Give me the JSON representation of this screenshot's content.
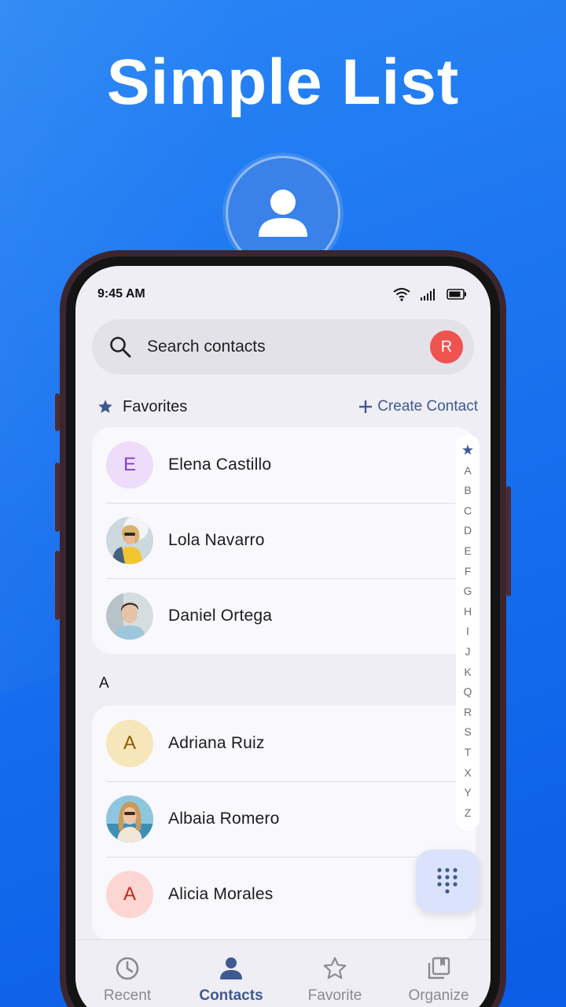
{
  "headline": "Simple List",
  "status_bar": {
    "time": "9:45 AM"
  },
  "search": {
    "placeholder": "Search contacts",
    "account_initial": "R"
  },
  "favorites": {
    "title": "Favorites",
    "create_label": "Create Contact",
    "contacts": [
      {
        "name": "Elena Castillo",
        "initial": "E",
        "avatar_bg": "#eedcfb",
        "avatar_fg": "#8a3fc9"
      },
      {
        "name": "Lola Navarro",
        "photo": true
      },
      {
        "name": "Daniel Ortega",
        "photo": true
      }
    ]
  },
  "sections": [
    {
      "letter": "A",
      "contacts": [
        {
          "name": "Adriana Ruiz",
          "initial": "A",
          "avatar_bg": "#f6e6b9",
          "avatar_fg": "#8a5a00"
        },
        {
          "name": "Albaia Romero",
          "photo": true
        },
        {
          "name": "Alicia Morales",
          "initial": "A",
          "avatar_bg": "#fcd6d2",
          "avatar_fg": "#c2271c"
        }
      ]
    }
  ],
  "alphabet_index": [
    "A",
    "B",
    "C",
    "D",
    "E",
    "F",
    "G",
    "H",
    "I",
    "J",
    "K",
    "Q",
    "R",
    "S",
    "T",
    "X",
    "Y",
    "Z"
  ],
  "bottom_nav": [
    {
      "label": "Recent",
      "icon": "clock-icon",
      "active": false
    },
    {
      "label": "Contacts",
      "icon": "person-icon",
      "active": true
    },
    {
      "label": "Favorite",
      "icon": "star-outline-icon",
      "active": false
    },
    {
      "label": "Organize",
      "icon": "organize-icon",
      "active": false
    }
  ],
  "colors": {
    "accent": "#3f5a91",
    "background": "#1a72ef",
    "account_avatar": "#ef5350"
  }
}
